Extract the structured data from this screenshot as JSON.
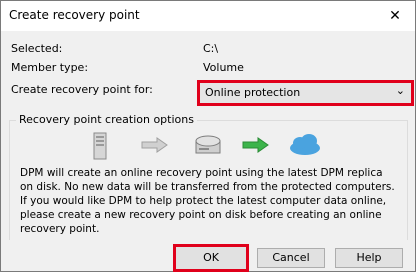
{
  "window": {
    "title": "Create recovery point",
    "close_glyph": "✕"
  },
  "fields": {
    "selected_label": "Selected:",
    "selected_value": "C:\\",
    "member_type_label": "Member type:",
    "member_type_value": "Volume",
    "create_for_label": "Create recovery point for:",
    "create_for_value": "Online protection"
  },
  "group": {
    "title": "Recovery point creation options",
    "icons": [
      "server-icon",
      "arrow-right-icon",
      "disk-icon",
      "arrow-right-green-icon",
      "cloud-icon"
    ],
    "description": "DPM will create an online recovery point using the latest DPM replica on disk. No new data will be transferred from the protected computers. If you would like DPM to help protect the latest computer data online, please create a new recovery point on disk before creating an online recovery point."
  },
  "buttons": {
    "ok": "OK",
    "cancel": "Cancel",
    "help": "Help"
  },
  "colors": {
    "highlight": "#e0001b",
    "cloud": "#4aa3df",
    "arrow_green": "#3cb44b"
  }
}
